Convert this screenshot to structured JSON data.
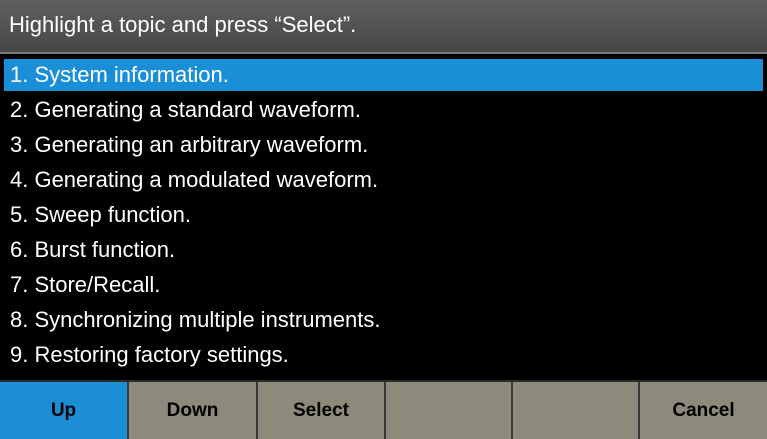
{
  "title": "Highlight a topic and press “Select”.",
  "topics": [
    "1. System information.",
    "2. Generating a standard waveform.",
    "3. Generating an arbitrary waveform.",
    "4. Generating a modulated waveform.",
    "5. Sweep function.",
    "6. Burst function.",
    "7. Store/Recall.",
    "8. Synchronizing multiple instruments.",
    "9. Restoring factory settings."
  ],
  "selected_topic_index": 0,
  "softkeys": [
    "Up",
    "Down",
    "Select",
    "",
    "",
    "Cancel"
  ],
  "active_softkey_index": 0,
  "colors": {
    "highlight": "#1a8fd8",
    "softkey": "#8c8a7a",
    "background": "#000000",
    "title_bar": "#4f4f4f"
  }
}
